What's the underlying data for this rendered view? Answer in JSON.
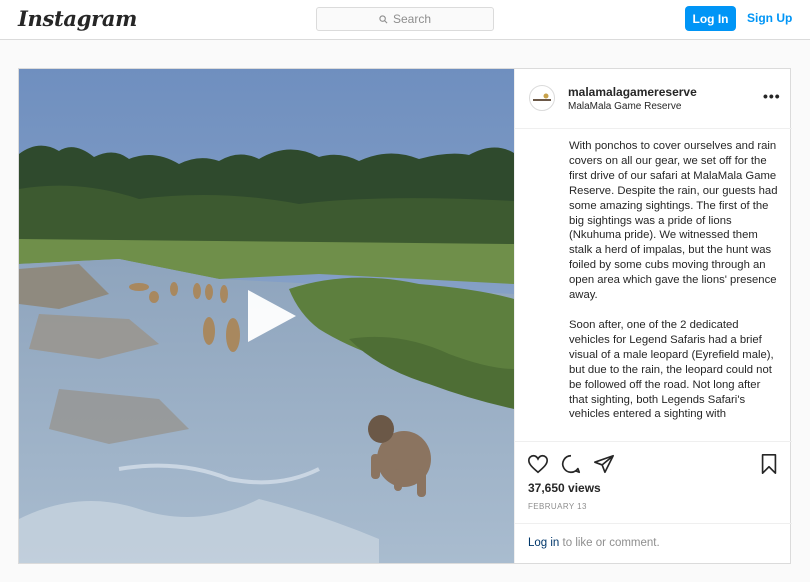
{
  "header": {
    "logo": "Instagram",
    "search_placeholder": "Search",
    "login_label": "Log In",
    "signup_label": "Sign Up"
  },
  "post": {
    "username": "malamalagamereserve",
    "full_name": "MalaMala Game Reserve",
    "more_label": "•••",
    "caption_paragraphs": [
      "With ponchos to cover ourselves and rain covers on all our gear, we set off for the first drive of our safari at MalaMala Game Reserve. Despite the rain, our guests had some amazing sightings. The first of the big sightings was a pride of lions (Nkuhuma pride). We witnessed them stalk a herd of impalas, but the hunt was foiled by some cubs moving through an open area which gave the lions' presence away.",
      "Soon after, one of the 2 dedicated vehicles for Legend Safaris had a brief visual of a male leopard (Eyrefield male), but due to the rain, the leopard could not be followed off the road. Not long after that sighting, both Legends Safari's vehicles entered a sighting with"
    ],
    "views": "37,650 views",
    "date": "FEBRUARY 13",
    "login_link": "Log in",
    "comment_prompt": " to like or comment."
  },
  "icons": {
    "search": "search-icon",
    "like": "heart-icon",
    "comment": "comment-icon",
    "share": "share-icon",
    "save": "bookmark-icon",
    "play": "play-icon"
  },
  "colors": {
    "accent": "#0095f6",
    "border": "#dbdbdb",
    "muted": "#8e8e8e",
    "link": "#00376b"
  }
}
